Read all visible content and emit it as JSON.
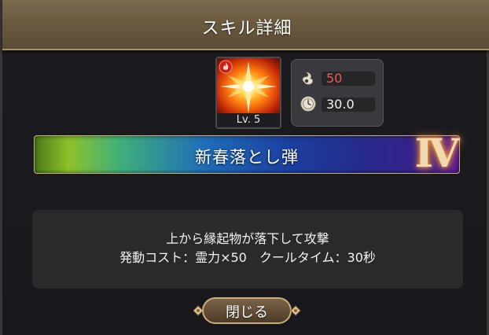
{
  "dialog": {
    "title": "スキル詳細",
    "close_label": "閉じる"
  },
  "skill": {
    "icon": "explosion-icon",
    "element_icon": "fire-icon",
    "level": "Lv. 5",
    "name": "新春落とし弾",
    "rank": "Ⅳ",
    "cost_icon": "spirit-power-icon",
    "cost": "50",
    "cooldown_icon": "clock-icon",
    "cooldown": "30.0",
    "description_line1": "上から縁起物が落下して攻撃",
    "description_line2": "発動コスト：霊力×50　クールタイム：30秒"
  },
  "colors": {
    "header": "#6a5a40",
    "cost_text": "#f05a55",
    "rank_glow": "#ff8c1a"
  }
}
